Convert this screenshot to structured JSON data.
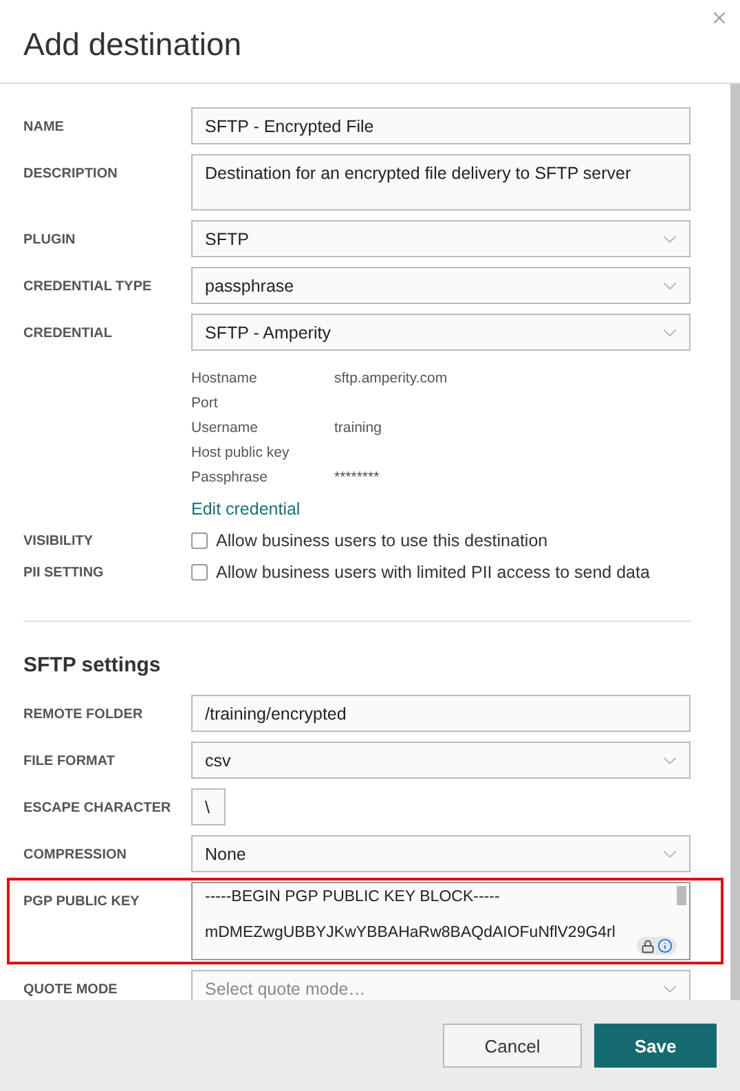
{
  "title": "Add destination",
  "general_fields": [
    {
      "kind": "text",
      "label": "NAME",
      "value": "SFTP - Encrypted File"
    },
    {
      "kind": "textarea",
      "label": "DESCRIPTION",
      "value": "Destination for an encrypted file delivery to SFTP server"
    },
    {
      "kind": "select",
      "label": "PLUGIN",
      "value": "SFTP"
    },
    {
      "kind": "select",
      "label": "CREDENTIAL TYPE",
      "value": "passphrase"
    },
    {
      "kind": "select",
      "label": "CREDENTIAL",
      "value": "SFTP - Amperity"
    }
  ],
  "credential_details": [
    {
      "key": "Hostname",
      "value": "sftp.amperity.com"
    },
    {
      "key": "Port"
    },
    {
      "key": "Username",
      "value": "training"
    },
    {
      "key": "Host public key"
    },
    {
      "key": "Passphrase",
      "value": "********"
    }
  ],
  "edit_credential_link": "Edit credential",
  "options": [
    {
      "label": "VISIBILITY",
      "text": "Allow business users to use this destination",
      "checked": false
    },
    {
      "label": "PII SETTING",
      "text": "Allow business users with limited PII access to send data",
      "checked": false
    }
  ],
  "settings_section": {
    "heading": "SFTP settings",
    "fields": [
      {
        "kind": "text",
        "label": "REMOTE FOLDER",
        "value": "/training/encrypted"
      },
      {
        "kind": "select",
        "label": "FILE FORMAT",
        "value": "csv"
      },
      {
        "kind": "short_text",
        "label": "ESCAPE CHARACTER",
        "value": "\\"
      },
      {
        "kind": "select",
        "label": "COMPRESSION",
        "value": "None"
      },
      {
        "kind": "key_area",
        "label": "PGP PUBLIC KEY",
        "highlighted": true,
        "lines": [
          "-----BEGIN PGP PUBLIC KEY BLOCK-----",
          "mDMEZwgUBBYJKwYBBAHaRw8BAQdAIOFuNflV29G4rl"
        ]
      },
      {
        "kind": "select",
        "label": "QUOTE MODE",
        "placeholder": "Select quote mode…"
      }
    ]
  },
  "buttons": [
    {
      "label": "Cancel",
      "primary": false
    },
    {
      "label": "Save",
      "primary": true
    }
  ]
}
